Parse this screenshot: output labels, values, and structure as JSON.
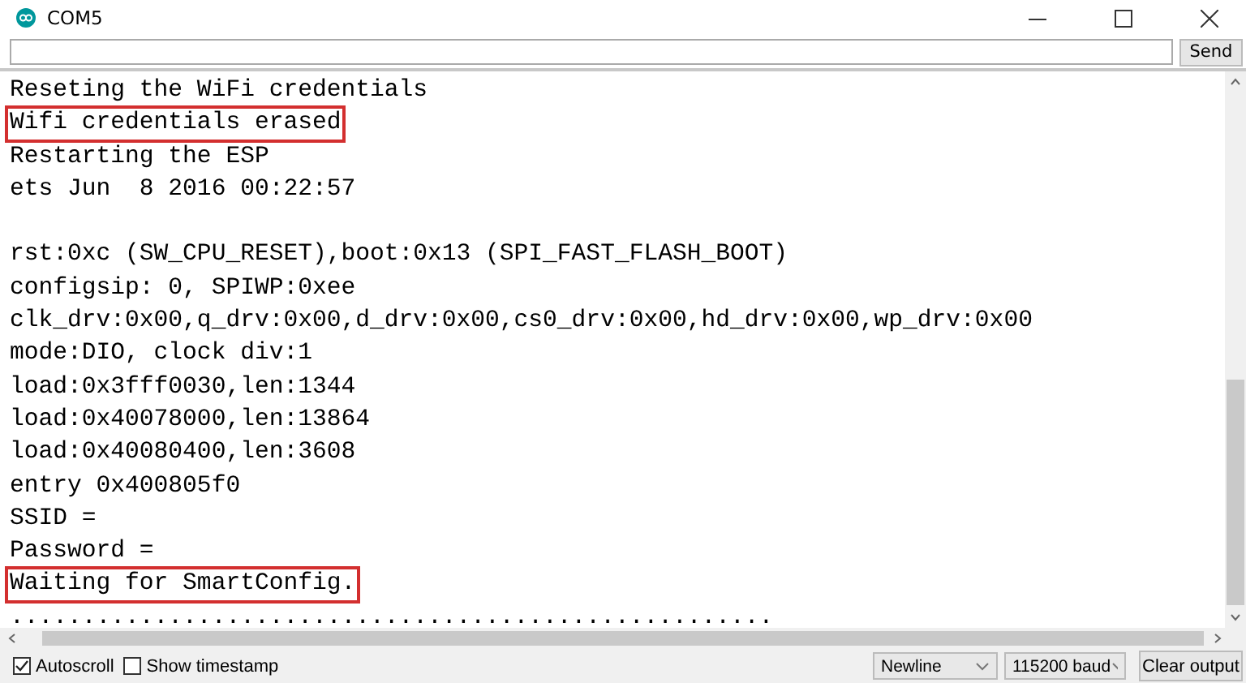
{
  "window": {
    "title": "COM5"
  },
  "send_button": "Send",
  "output_lines": [
    {
      "text": "Reseting the WiFi credentials",
      "highlighted": false,
      "space_before": false
    },
    {
      "text": "Wifi credentials erased",
      "highlighted": true,
      "space_before": false
    },
    {
      "text": "Restarting the ESP",
      "highlighted": false,
      "space_before": false
    },
    {
      "text": "ets Jun  8 2016 00:22:57",
      "highlighted": false,
      "space_before": false
    },
    {
      "text": "rst:0xc (SW_CPU_RESET),boot:0x13 (SPI_FAST_FLASH_BOOT)",
      "highlighted": false,
      "space_before": true
    },
    {
      "text": "configsip: 0, SPIWP:0xee",
      "highlighted": false,
      "space_before": false
    },
    {
      "text": "clk_drv:0x00,q_drv:0x00,d_drv:0x00,cs0_drv:0x00,hd_drv:0x00,wp_drv:0x00",
      "highlighted": false,
      "space_before": false
    },
    {
      "text": "mode:DIO, clock div:1",
      "highlighted": false,
      "space_before": false
    },
    {
      "text": "load:0x3fff0030,len:1344",
      "highlighted": false,
      "space_before": false
    },
    {
      "text": "load:0x40078000,len:13864",
      "highlighted": false,
      "space_before": false
    },
    {
      "text": "load:0x40080400,len:3608",
      "highlighted": false,
      "space_before": false
    },
    {
      "text": "entry 0x400805f0",
      "highlighted": false,
      "space_before": false
    },
    {
      "text": "SSID =",
      "highlighted": false,
      "space_before": false
    },
    {
      "text": "Password =",
      "highlighted": false,
      "space_before": false
    },
    {
      "text": "Waiting for SmartConfig.",
      "highlighted": true,
      "space_before": false
    },
    {
      "text": ".....................................................",
      "highlighted": false,
      "space_before": false
    }
  ],
  "options": [
    {
      "label": "Autoscroll",
      "checked": true
    },
    {
      "label": "Show timestamp",
      "checked": false
    }
  ],
  "line_ending": "Newline",
  "baud_rate": "115200 baud",
  "clear_button": "Clear output"
}
